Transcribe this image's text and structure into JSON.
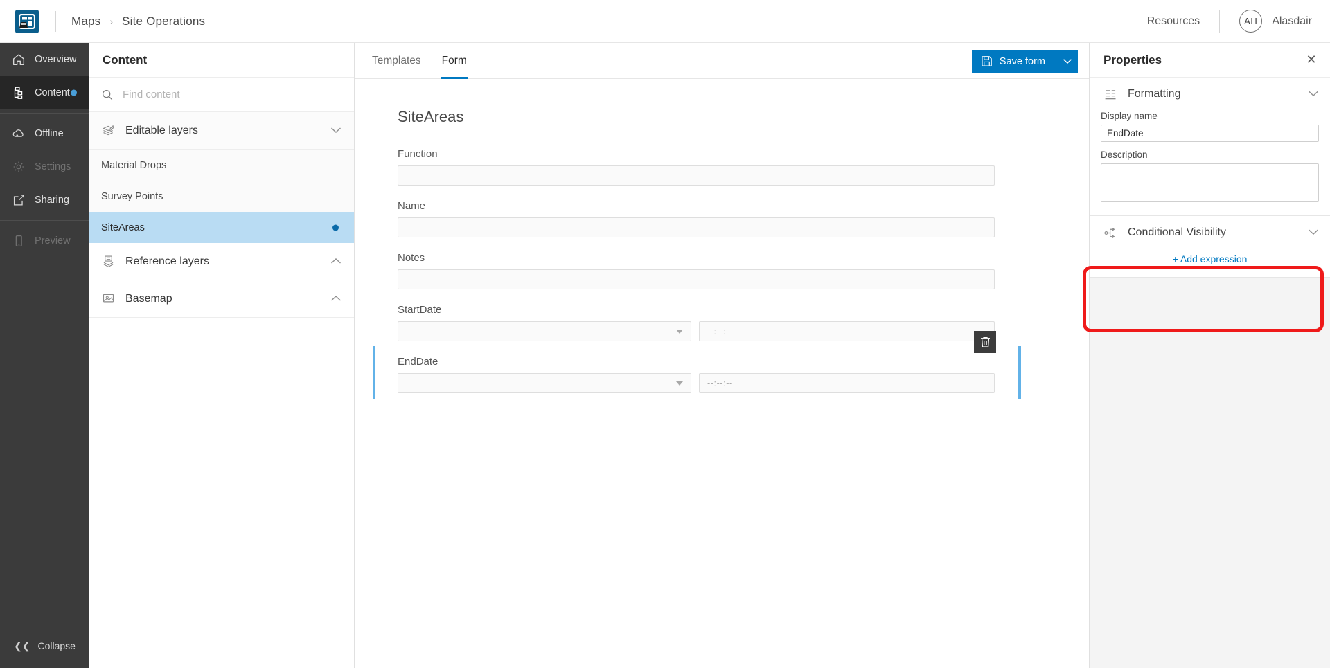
{
  "topbar": {
    "logo_name": "app-logo",
    "breadcrumb": {
      "root": "Maps",
      "separator": "›",
      "current": "Site Operations"
    },
    "resources_label": "Resources",
    "user": {
      "initials": "AH",
      "name": "Alasdair"
    }
  },
  "leftnav": {
    "items": [
      {
        "label": "Overview",
        "icon": "home-icon",
        "state": "normal"
      },
      {
        "label": "Content",
        "icon": "content-tree-icon",
        "state": "active",
        "dot": true
      },
      {
        "label": "Offline",
        "icon": "cloud-offline-icon",
        "state": "normal"
      },
      {
        "label": "Settings",
        "icon": "gear-icon",
        "state": "disabled"
      },
      {
        "label": "Sharing",
        "icon": "share-icon",
        "state": "normal"
      },
      {
        "label": "Preview",
        "icon": "mobile-preview-icon",
        "state": "disabled"
      }
    ],
    "collapse_label": "Collapse",
    "collapse_icon": "chevron-double-left-icon"
  },
  "content_panel": {
    "title": "Content",
    "search": {
      "placeholder": "Find content",
      "value": "",
      "icon": "search-icon"
    },
    "groups": [
      {
        "label": "Editable layers",
        "icon": "editable-layers-icon",
        "chevron": "chevron-down-icon",
        "layers": [
          {
            "label": "Material Drops",
            "selected": false
          },
          {
            "label": "Survey Points",
            "selected": false
          },
          {
            "label": "SiteAreas",
            "selected": true
          }
        ]
      },
      {
        "label": "Reference layers",
        "icon": "reference-layers-icon",
        "chevron": "chevron-up-icon",
        "layers": []
      },
      {
        "label": "Basemap",
        "icon": "basemap-icon",
        "chevron": "chevron-up-icon",
        "layers": []
      }
    ]
  },
  "main": {
    "tabs": [
      {
        "label": "Templates",
        "active": false
      },
      {
        "label": "Form",
        "active": true
      }
    ],
    "save_button": {
      "label": "Save form",
      "icon": "save-disk-icon",
      "caret_icon": "chevron-down-icon"
    },
    "form": {
      "title": "SiteAreas",
      "fields": [
        {
          "label": "Function",
          "type": "text",
          "value": "",
          "selected": false
        },
        {
          "label": "Name",
          "type": "text",
          "value": "",
          "selected": false
        },
        {
          "label": "Notes",
          "type": "text",
          "value": "",
          "selected": false
        },
        {
          "label": "StartDate",
          "type": "datetime",
          "date_value": "",
          "time_placeholder": "--:--:--",
          "selected": false
        },
        {
          "label": "EndDate",
          "type": "datetime",
          "date_value": "",
          "time_placeholder": "--:--:--",
          "selected": true,
          "delete_icon": "trash-icon"
        }
      ]
    }
  },
  "properties": {
    "title": "Properties",
    "close_icon": "close-icon",
    "sections": [
      {
        "label": "Formatting",
        "icon": "formatting-icon",
        "chevron": "chevron-down-icon",
        "fields": [
          {
            "label": "Display name",
            "value": "EndDate",
            "type": "input"
          },
          {
            "label": "Description",
            "value": "",
            "type": "textarea"
          }
        ]
      },
      {
        "label": "Conditional Visibility",
        "icon": "conditional-visibility-icon",
        "chevron": "chevron-down-icon",
        "add_link": "+ Add expression",
        "highlighted": true
      }
    ]
  },
  "annotation": {
    "color": "#ef1a1a",
    "shape": "rounded-rectangle",
    "target": "conditional-visibility-section"
  },
  "colors": {
    "accent": "#0079c1",
    "nav_bg": "#3b3b3b",
    "selected_row": "#b9dcf3",
    "annotation_red": "#ef1a1a"
  }
}
